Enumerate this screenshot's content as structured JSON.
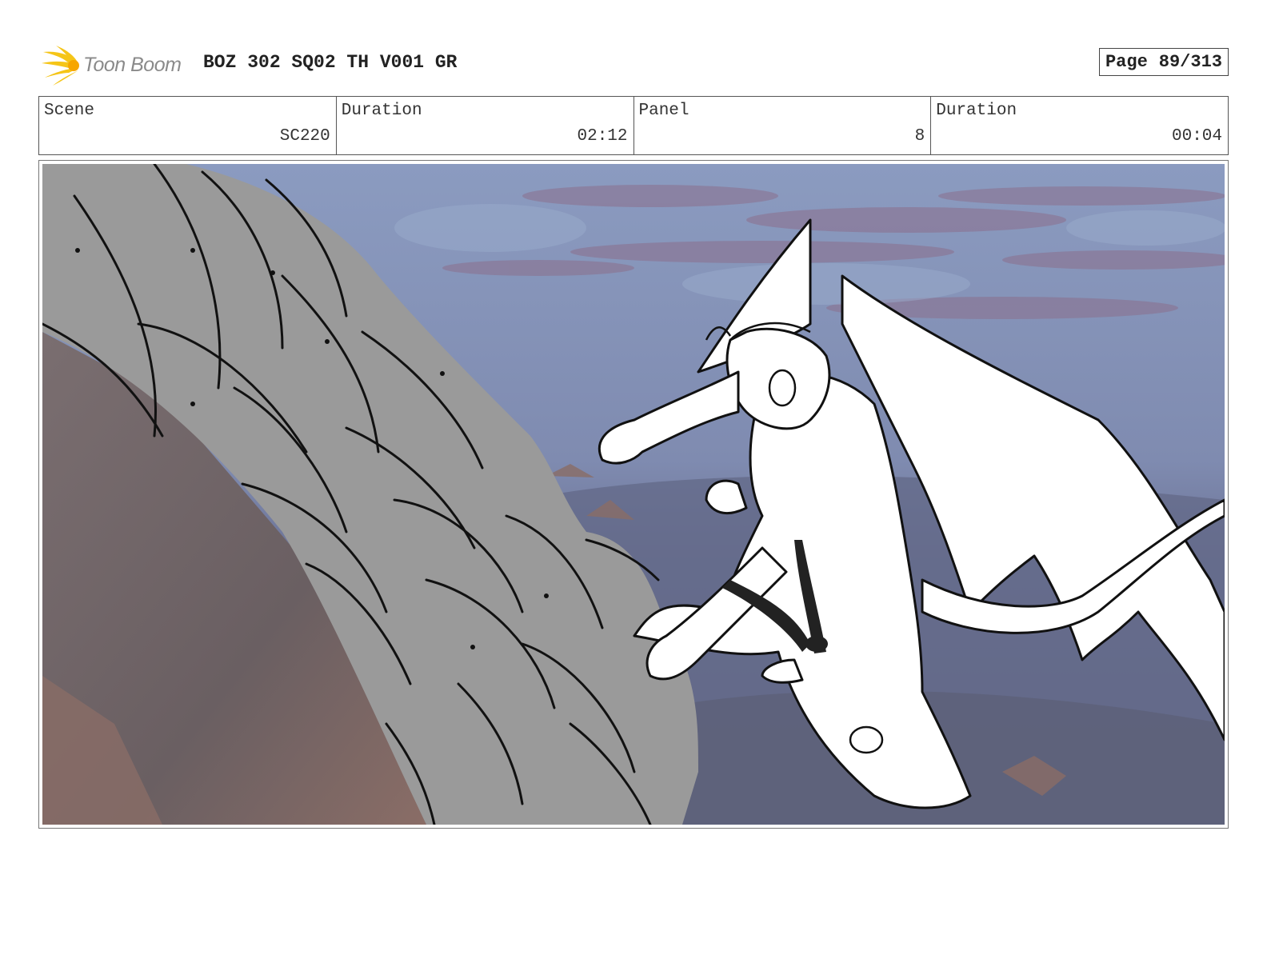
{
  "header": {
    "logo_text": "Toon Boom",
    "title": "BOZ 302 SQ02 TH V001 GR",
    "page_label": "Page",
    "page_value": "89/313"
  },
  "info": {
    "scene_label": "Scene",
    "scene_value": "SC220",
    "duration_label": "Duration",
    "duration_value": "02:12",
    "panel_label": "Panel",
    "panel_value": "8",
    "panel_duration_label": "Duration",
    "panel_duration_value": "00:04"
  },
  "colors": {
    "logo_yellow": "#f5c518",
    "sky_top": "#8b9bc0",
    "sky_cloud": "#8a6f8a",
    "creature_gray": "#9a9a9a",
    "rock_dark": "#6b6060",
    "ground_blue": "#6f7a99"
  }
}
